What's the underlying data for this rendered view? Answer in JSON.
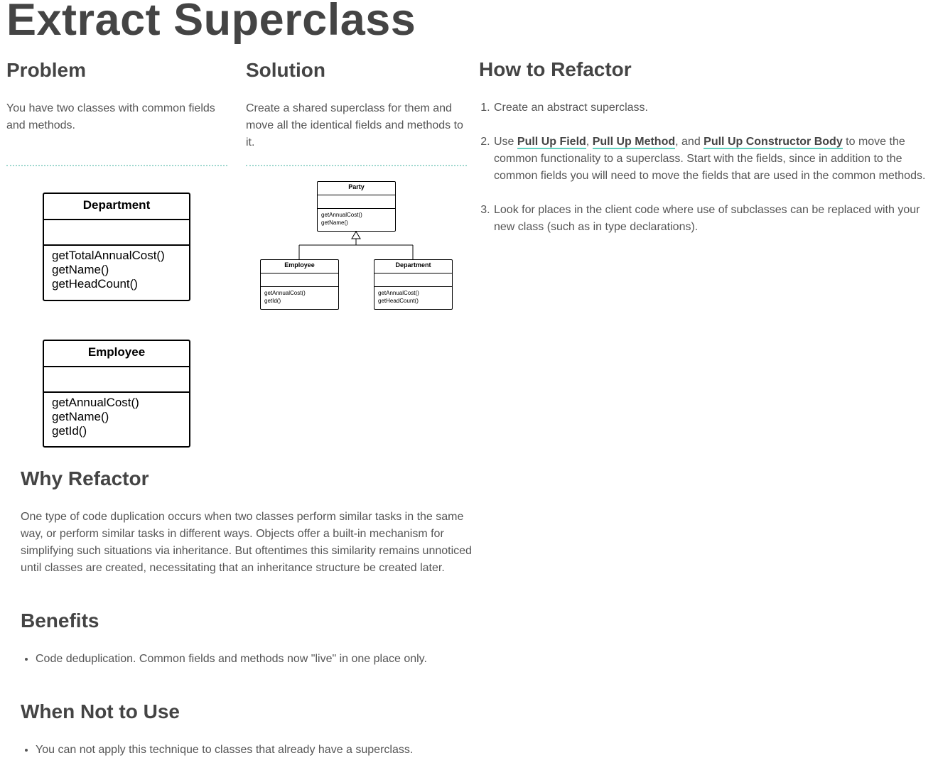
{
  "page": {
    "title": "Extract Superclass"
  },
  "problem": {
    "heading": "Problem",
    "text": "You have two classes with common fields and methods.",
    "diagram": {
      "department": {
        "name": "Department",
        "methods": [
          "getTotalAnnualCost()",
          "getName()",
          "getHeadCount()"
        ]
      },
      "employee": {
        "name": "Employee",
        "methods": [
          "getAnnualCost()",
          "getName()",
          "getId()"
        ]
      }
    }
  },
  "solution": {
    "heading": "Solution",
    "text": "Create a shared superclass for them and move all the identical fields and methods to it.",
    "diagram": {
      "party": {
        "name": "Party",
        "methods": [
          "getAnnualCost()",
          "getName()"
        ]
      },
      "employee": {
        "name": "Employee",
        "methods": [
          "getAnnualCost()",
          "getId()"
        ]
      },
      "department": {
        "name": "Department",
        "methods": [
          "getAnnualCost()",
          "getHeadCount()"
        ]
      }
    }
  },
  "how_to": {
    "heading": "How to Refactor",
    "steps": {
      "step1": "Create an abstract superclass.",
      "step2_prefix": "Use ",
      "link_pull_up_field": "Pull Up Field",
      "sep1": ", ",
      "link_pull_up_method": "Pull Up Method",
      "sep2": ", and ",
      "link_pull_up_constructor": "Pull Up Constructor Body",
      "step2_suffix": " to move the common functionality to a superclass. Start with the fields, since in addition to the common fields you will need to move the fields that are used in the common methods.",
      "step3": "Look for places in the client code where use of subclasses can be replaced with your new class (such as in type declarations)."
    }
  },
  "why": {
    "heading": "Why Refactor",
    "text": "One type of code duplication occurs when two classes perform similar tasks in the same way, or perform similar tasks in different ways. Objects offer a built-in mechanism for simplifying such situations via inheritance. But oftentimes this similarity remains unnoticed until classes are created, necessitating that an inheritance structure be created later."
  },
  "benefits": {
    "heading": "Benefits",
    "items": [
      "Code deduplication. Common fields and methods now \"live\" in one place only."
    ]
  },
  "when_not": {
    "heading": "When Not to Use",
    "items": [
      "You can not apply this technique to classes that already have a superclass."
    ]
  },
  "colors": {
    "text": "#444444",
    "accent_underline": "#5fd0bf",
    "divider": "#9fd8cf"
  }
}
